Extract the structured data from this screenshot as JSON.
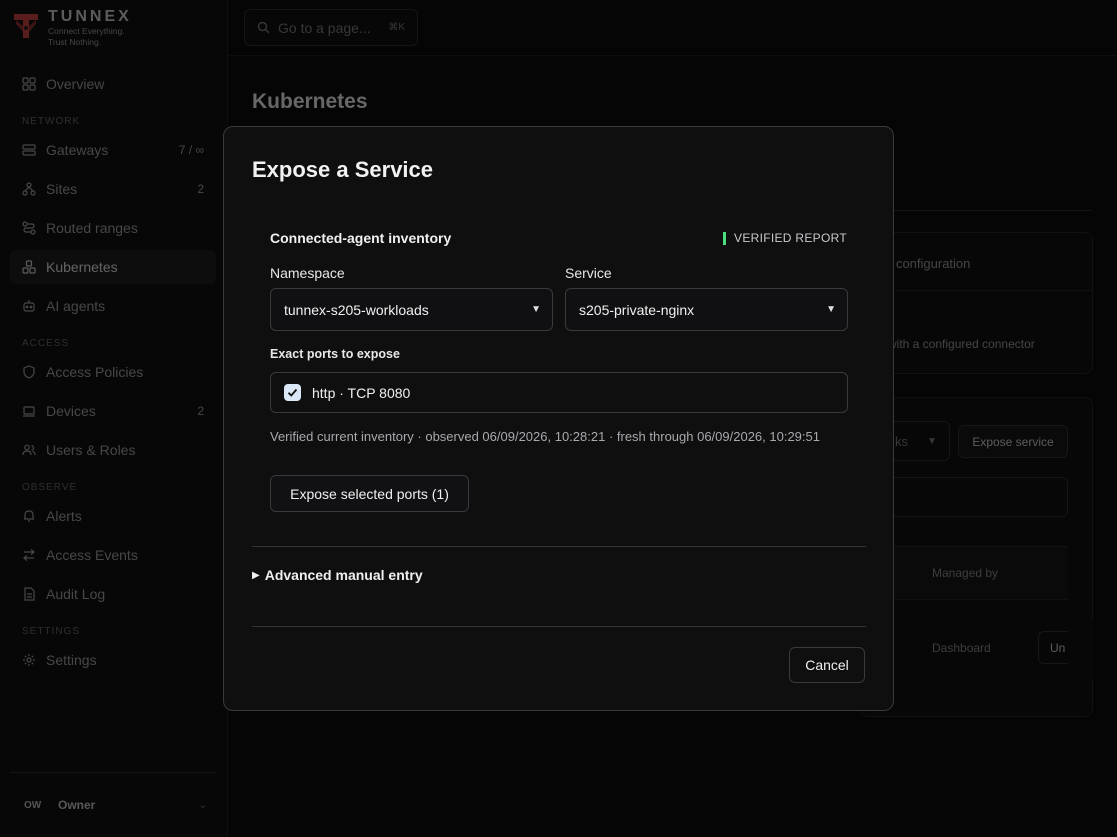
{
  "brand": {
    "name": "TUNNEX",
    "tagline_1": "Connect Everything.",
    "tagline_2": "Trust Nothing."
  },
  "sidebar": {
    "overview": "Overview",
    "section_network": "NETWORK",
    "gateways": "Gateways",
    "gateways_count": "7 / ∞",
    "sites": "Sites",
    "sites_count": "2",
    "routed_ranges": "Routed ranges",
    "kubernetes": "Kubernetes",
    "ai_agents": "AI agents",
    "section_access": "ACCESS",
    "access_policies": "Access Policies",
    "devices": "Devices",
    "devices_count": "2",
    "users_roles": "Users & Roles",
    "section_observe": "OBSERVE",
    "alerts": "Alerts",
    "access_events": "Access Events",
    "audit_log": "Audit Log",
    "section_settings": "SETTINGS",
    "settings": "Settings"
  },
  "user": {
    "initials": "OW",
    "role": "Owner"
  },
  "topbar": {
    "search_placeholder": "Go to a page...",
    "search_shortcut": "⌘K"
  },
  "page": {
    "title": "Kubernetes",
    "bg_config_text": "r configuration",
    "bg_connector_text": "with a configured connector",
    "bg_select_text": "ks",
    "bg_expose_button": "Expose service",
    "bg_col_managed_by": "Managed by",
    "bg_cell_dashboard": "Dashboard",
    "bg_un_button": "Un"
  },
  "modal": {
    "title": "Expose a Service",
    "inventory_title": "Connected-agent inventory",
    "verified_badge": "VERIFIED REPORT",
    "namespace_label": "Namespace",
    "namespace_value": "tunnex-s205-workloads",
    "service_label": "Service",
    "service_value": "s205-private-nginx",
    "ports_label": "Exact ports to expose",
    "port_item": "http · TCP 8080",
    "port_checked": true,
    "inventory_note": "Verified current inventory · observed 06/09/2026, 10:28:21 · fresh through 06/09/2026, 10:29:51",
    "expose_button": "Expose selected ports (1)",
    "advanced_label": "Advanced manual entry",
    "cancel_button": "Cancel"
  },
  "colors": {
    "verified_accent": "#4ade80",
    "checkbox_fill": "#dbe8f7"
  }
}
